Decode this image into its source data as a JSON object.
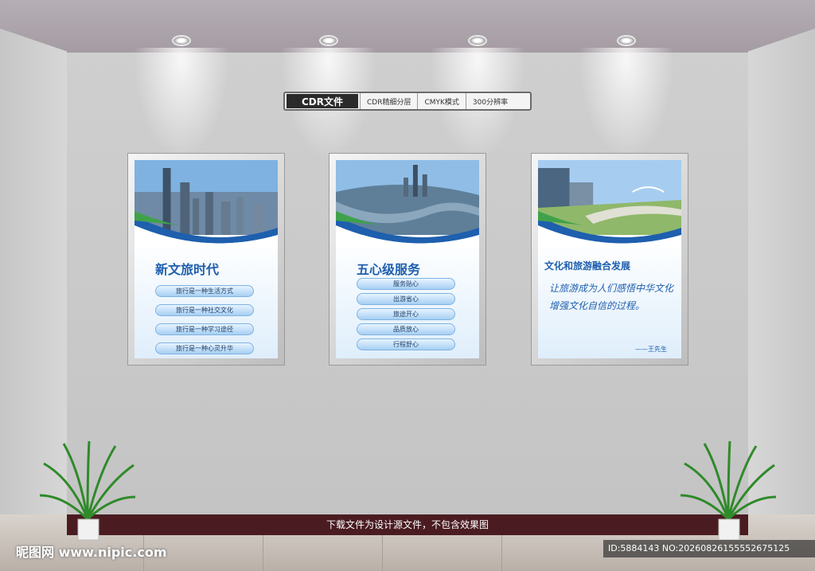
{
  "badge": {
    "main": "CDR文件",
    "items": [
      "CDR精细分层",
      "CMYK模式",
      "300分辨率"
    ]
  },
  "poster1": {
    "title": "新文旅时代",
    "pills": [
      "旅行是一种生活方式",
      "旅行是一种社交文化",
      "旅行是一种学习途径",
      "旅行是一种心灵升华"
    ]
  },
  "poster2": {
    "title": "五心级服务",
    "pills": [
      "服务贴心",
      "出游省心",
      "旅途开心",
      "品质放心",
      "行程舒心"
    ]
  },
  "poster3": {
    "title": "文化和旅游融合发展",
    "quote": "让旅游成为人们感悟中华文化增强文化自信的过程。",
    "author": "——王先生"
  },
  "footer": {
    "notice": "下载文件为设计源文件，不包含效果图",
    "watermark": "昵图网 www.nipic.com",
    "id_text": "ID:5884143 NO:20260826155552675125"
  },
  "colors": {
    "accent": "#1e5fae",
    "skirting": "#4a1c22"
  }
}
